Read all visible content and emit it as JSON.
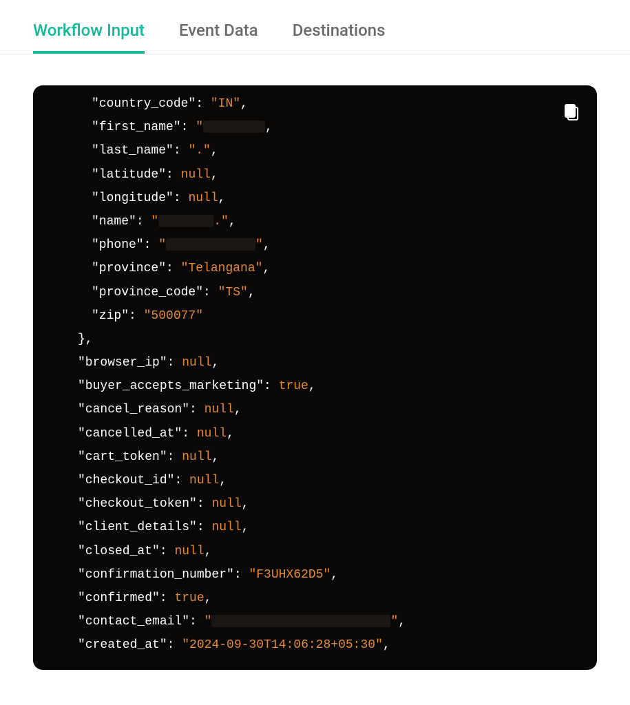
{
  "tabs": [
    {
      "label": "Workflow Input",
      "active": true
    },
    {
      "label": "Event Data",
      "active": false
    },
    {
      "label": "Destinations",
      "active": false
    }
  ],
  "code": {
    "lines": [
      {
        "indent": 2,
        "key": "country_code",
        "val": "\"IN\"",
        "trailing": ","
      },
      {
        "indent": 2,
        "key": "first_name",
        "val_prefix": "\"",
        "redacted": "w1",
        "trailing": ","
      },
      {
        "indent": 2,
        "key": "last_name",
        "val": "\".\"",
        "trailing": ","
      },
      {
        "indent": 2,
        "key": "latitude",
        "val": "null",
        "trailing": ","
      },
      {
        "indent": 2,
        "key": "longitude",
        "val": "null",
        "trailing": ","
      },
      {
        "indent": 2,
        "key": "name",
        "val_prefix": "\"",
        "redacted": "w2",
        "val_suffix": ".\"",
        "trailing": ","
      },
      {
        "indent": 2,
        "key": "phone",
        "val_prefix": "\"",
        "redacted": "w3",
        "val_suffix": "\"",
        "trailing": ","
      },
      {
        "indent": 2,
        "key": "province",
        "val": "\"Telangana\"",
        "trailing": ","
      },
      {
        "indent": 2,
        "key": "province_code",
        "val": "\"TS\"",
        "trailing": ","
      },
      {
        "indent": 2,
        "key": "zip",
        "val": "\"500077\"",
        "trailing": ""
      },
      {
        "indent": 1,
        "raw": "},"
      },
      {
        "indent": 1,
        "key": "browser_ip",
        "val": "null",
        "trailing": ","
      },
      {
        "indent": 1,
        "key": "buyer_accepts_marketing",
        "val": "true",
        "trailing": ","
      },
      {
        "indent": 1,
        "key": "cancel_reason",
        "val": "null",
        "trailing": ","
      },
      {
        "indent": 1,
        "key": "cancelled_at",
        "val": "null",
        "trailing": ","
      },
      {
        "indent": 1,
        "key": "cart_token",
        "val": "null",
        "trailing": ","
      },
      {
        "indent": 1,
        "key": "checkout_id",
        "val": "null",
        "trailing": ","
      },
      {
        "indent": 1,
        "key": "checkout_token",
        "val": "null",
        "trailing": ","
      },
      {
        "indent": 1,
        "key": "client_details",
        "val": "null",
        "trailing": ","
      },
      {
        "indent": 1,
        "key": "closed_at",
        "val": "null",
        "trailing": ","
      },
      {
        "indent": 1,
        "key": "confirmation_number",
        "val": "\"F3UHX62D5\"",
        "trailing": ","
      },
      {
        "indent": 1,
        "key": "confirmed",
        "val": "true",
        "trailing": ","
      },
      {
        "indent": 1,
        "key": "contact_email",
        "val_prefix": "\"",
        "redacted": "w4",
        "val_suffix": "\"",
        "trailing": ","
      },
      {
        "indent": 1,
        "key": "created_at",
        "val": "\"2024-09-30T14:06:28+05:30\"",
        "trailing": ","
      }
    ]
  }
}
